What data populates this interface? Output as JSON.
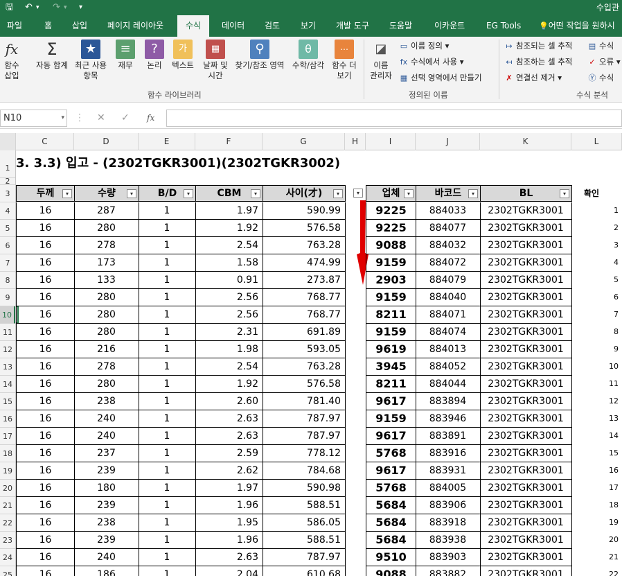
{
  "title_bar": {
    "document_title": "수입관",
    "quick_access": [
      "save-icon",
      "undo-icon",
      "redo-icon",
      "customize-icon"
    ]
  },
  "tabs": [
    "파일",
    "홈",
    "삽입",
    "페이지 레이아웃",
    "수식",
    "데이터",
    "검토",
    "보기",
    "개발 도구",
    "도움말",
    "이카운트",
    "EG Tools",
    "어떤 작업을 원하시"
  ],
  "active_tab": "수식",
  "ribbon": {
    "insert_function": "함수\n삽입",
    "autosum": "자동 합계",
    "recent": "최근 사용\n항목",
    "financial": "재무",
    "logical": "논리",
    "text": "텍스트",
    "datetime": "날짜 및\n시간",
    "lookup": "찾기/참조 영역",
    "math": "수학/삼각",
    "more": "함수 더\n보기",
    "function_library_label": "함수 라이브러리",
    "name_manager": "이름\n관리자",
    "define_name": "이름 정의",
    "use_in_formula": "수식에서 사용",
    "create_from_selection": "선택 영역에서 만들기",
    "defined_names_label": "정의된 이름",
    "trace_precedents": "참조되는 셀 추적",
    "trace_dependents": "참조하는 셀 추적",
    "remove_arrows": "연결선 제거",
    "show_formulas": "수식",
    "error_checking": "오류",
    "evaluate": "수식",
    "formula_auditing_label": "수식 분석"
  },
  "formula_bar": {
    "name_box": "N10",
    "cancel": "✕",
    "enter": "✓",
    "fx": "fx",
    "formula": ""
  },
  "columns": [
    "C",
    "D",
    "E",
    "F",
    "G",
    "H",
    "I",
    "J",
    "K",
    "L"
  ],
  "title_cell": "3. 3.3) 입고 - (2302TGKR3001)(2302TGKR3002)",
  "headers": {
    "thickness": "두께",
    "qty": "수량",
    "bd": "B/D",
    "cbm": "CBM",
    "size": "사이(才)",
    "vendor": "업체",
    "barcode": "바코드",
    "bl": "BL",
    "check": "확인"
  },
  "rows": [
    {
      "row": 4,
      "t": 16,
      "qty": 287,
      "bd": 1,
      "cbm": "1.97",
      "size": "590.99",
      "vendor": "9225",
      "barcode": "884033",
      "bl": "2302TGKR3001",
      "check": 1
    },
    {
      "row": 5,
      "t": 16,
      "qty": 280,
      "bd": 1,
      "cbm": "1.92",
      "size": "576.58",
      "vendor": "9225",
      "barcode": "884077",
      "bl": "2302TGKR3001",
      "check": 2
    },
    {
      "row": 6,
      "t": 16,
      "qty": 278,
      "bd": 1,
      "cbm": "2.54",
      "size": "763.28",
      "vendor": "9088",
      "barcode": "884032",
      "bl": "2302TGKR3001",
      "check": 3
    },
    {
      "row": 7,
      "t": 16,
      "qty": 173,
      "bd": 1,
      "cbm": "1.58",
      "size": "474.99",
      "vendor": "9159",
      "barcode": "884072",
      "bl": "2302TGKR3001",
      "check": 4
    },
    {
      "row": 8,
      "t": 16,
      "qty": 133,
      "bd": 1,
      "cbm": "0.91",
      "size": "273.87",
      "vendor": "2903",
      "barcode": "884079",
      "bl": "2302TGKR3001",
      "check": 5
    },
    {
      "row": 9,
      "t": 16,
      "qty": 280,
      "bd": 1,
      "cbm": "2.56",
      "size": "768.77",
      "vendor": "9159",
      "barcode": "884040",
      "bl": "2302TGKR3001",
      "check": 6
    },
    {
      "row": 10,
      "t": 16,
      "qty": 280,
      "bd": 1,
      "cbm": "2.56",
      "size": "768.77",
      "vendor": "8211",
      "barcode": "884071",
      "bl": "2302TGKR3001",
      "check": 7
    },
    {
      "row": 11,
      "t": 16,
      "qty": 280,
      "bd": 1,
      "cbm": "2.31",
      "size": "691.89",
      "vendor": "9159",
      "barcode": "884074",
      "bl": "2302TGKR3001",
      "check": 8
    },
    {
      "row": 12,
      "t": 16,
      "qty": 216,
      "bd": 1,
      "cbm": "1.98",
      "size": "593.05",
      "vendor": "9619",
      "barcode": "884013",
      "bl": "2302TGKR3001",
      "check": 9
    },
    {
      "row": 13,
      "t": 16,
      "qty": 278,
      "bd": 1,
      "cbm": "2.54",
      "size": "763.28",
      "vendor": "3945",
      "barcode": "884052",
      "bl": "2302TGKR3001",
      "check": 10
    },
    {
      "row": 14,
      "t": 16,
      "qty": 280,
      "bd": 1,
      "cbm": "1.92",
      "size": "576.58",
      "vendor": "8211",
      "barcode": "884044",
      "bl": "2302TGKR3001",
      "check": 11
    },
    {
      "row": 15,
      "t": 16,
      "qty": 238,
      "bd": 1,
      "cbm": "2.60",
      "size": "781.40",
      "vendor": "9617",
      "barcode": "883894",
      "bl": "2302TGKR3001",
      "check": 12
    },
    {
      "row": 16,
      "t": 16,
      "qty": 240,
      "bd": 1,
      "cbm": "2.63",
      "size": "787.97",
      "vendor": "9159",
      "barcode": "883946",
      "bl": "2302TGKR3001",
      "check": 13
    },
    {
      "row": 17,
      "t": 16,
      "qty": 240,
      "bd": 1,
      "cbm": "2.63",
      "size": "787.97",
      "vendor": "9617",
      "barcode": "883891",
      "bl": "2302TGKR3001",
      "check": 14
    },
    {
      "row": 18,
      "t": 16,
      "qty": 237,
      "bd": 1,
      "cbm": "2.59",
      "size": "778.12",
      "vendor": "5768",
      "barcode": "883916",
      "bl": "2302TGKR3001",
      "check": 15
    },
    {
      "row": 19,
      "t": 16,
      "qty": 239,
      "bd": 1,
      "cbm": "2.62",
      "size": "784.68",
      "vendor": "9617",
      "barcode": "883931",
      "bl": "2302TGKR3001",
      "check": 16
    },
    {
      "row": 20,
      "t": 16,
      "qty": 180,
      "bd": 1,
      "cbm": "1.97",
      "size": "590.98",
      "vendor": "5768",
      "barcode": "884005",
      "bl": "2302TGKR3001",
      "check": 17
    },
    {
      "row": 21,
      "t": 16,
      "qty": 239,
      "bd": 1,
      "cbm": "1.96",
      "size": "588.51",
      "vendor": "5684",
      "barcode": "883906",
      "bl": "2302TGKR3001",
      "check": 18
    },
    {
      "row": 22,
      "t": 16,
      "qty": 238,
      "bd": 1,
      "cbm": "1.95",
      "size": "586.05",
      "vendor": "5684",
      "barcode": "883918",
      "bl": "2302TGKR3001",
      "check": 19
    },
    {
      "row": 23,
      "t": 16,
      "qty": 239,
      "bd": 1,
      "cbm": "1.96",
      "size": "588.51",
      "vendor": "5684",
      "barcode": "883938",
      "bl": "2302TGKR3001",
      "check": 20
    },
    {
      "row": 24,
      "t": 16,
      "qty": 240,
      "bd": 1,
      "cbm": "2.63",
      "size": "787.97",
      "vendor": "9510",
      "barcode": "883903",
      "bl": "2302TGKR3001",
      "check": 21
    },
    {
      "row": 25,
      "t": 16,
      "qty": 186,
      "bd": 1,
      "cbm": "2.04",
      "size": "610.68",
      "vendor": "9088",
      "barcode": "883882",
      "bl": "2302TGKR3001",
      "check": 22
    }
  ],
  "colors": {
    "accent": "#217346",
    "arrow": "#e00000",
    "header_fill": "#d9d9d9"
  }
}
